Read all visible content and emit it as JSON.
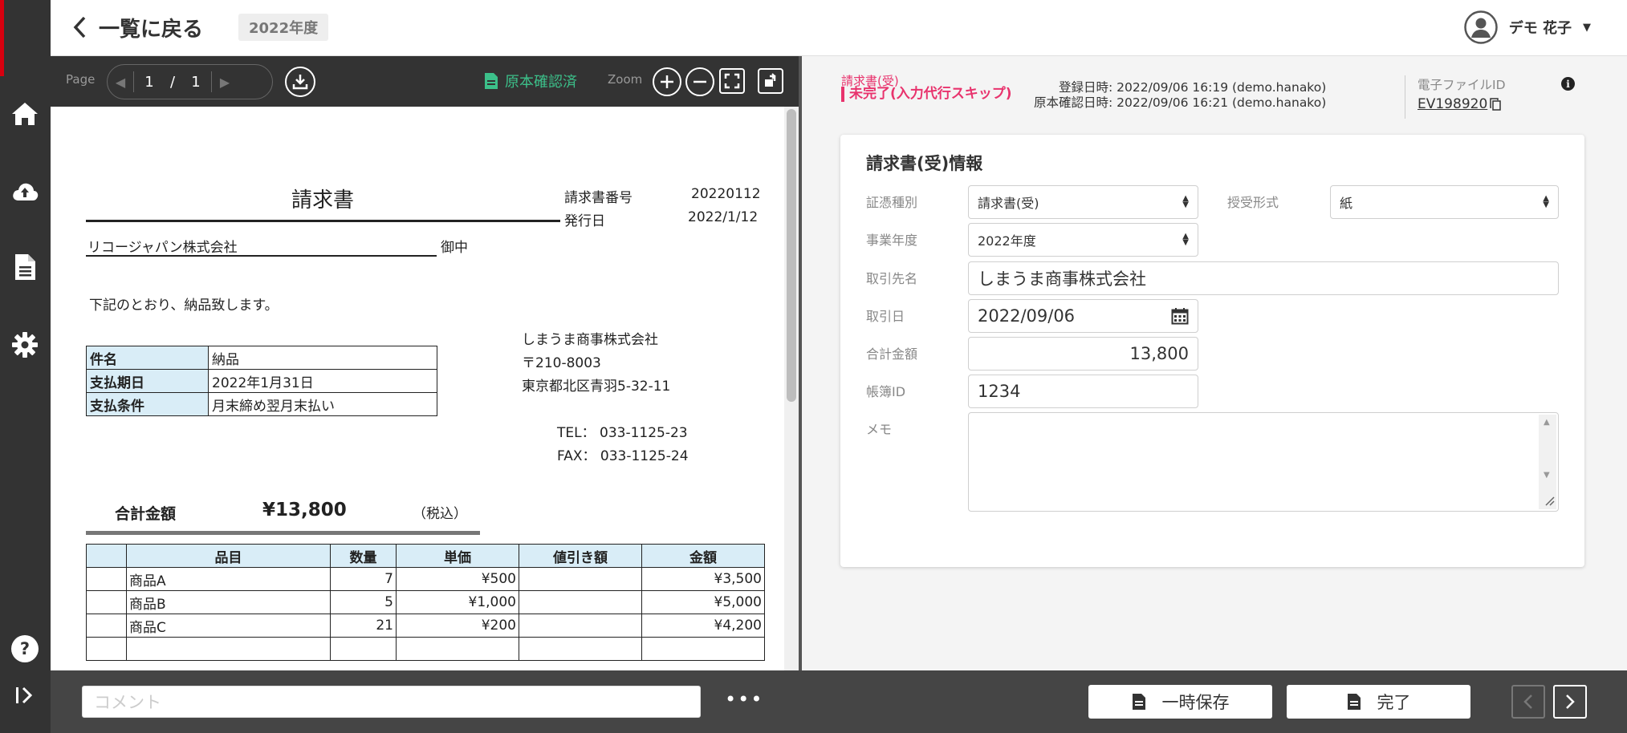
{
  "header": {
    "back_label": "一覧に戻る",
    "fiscal_year_badge": "2022年度",
    "user_name": "デモ 花子",
    "user_caret": "▼"
  },
  "viewer": {
    "page_label": "Page",
    "current_page": "1",
    "page_separator": "/",
    "total_pages": "1",
    "confirmed_label": "原本確認済",
    "zoom_label": "Zoom",
    "confirmed_color": "#3cc08a"
  },
  "document": {
    "title": "請求書",
    "invoice_no_label": "請求書番号",
    "invoice_no": "20220112",
    "issue_date_label": "発行日",
    "issue_date": "2022/1/12",
    "recipient": "リコージャパン株式会社",
    "honorific": "御中",
    "intro": "下記のとおり、納品致します。",
    "issuer_name": "しまうま商事株式会社",
    "issuer_zip": "〒210-8003",
    "issuer_address": "東京都北区青羽5-32-11",
    "tel": "TEL： 033-1125-23",
    "fax": "FAX： 033-1125-24",
    "info_rows": [
      {
        "label": "件名",
        "value": "納品"
      },
      {
        "label": "支払期日",
        "value": "2022年1月31日"
      },
      {
        "label": "支払条件",
        "value": "月末締め翌月末払い"
      }
    ],
    "total_label": "合計金額",
    "total_value": "¥13,800",
    "tax_note": "（税込）",
    "item_headers": [
      "",
      "品目",
      "数量",
      "単価",
      "値引き額",
      "金額"
    ],
    "items": [
      [
        "",
        "商品A",
        "7",
        "¥500",
        "",
        "¥3,500"
      ],
      [
        "",
        "商品B",
        "5",
        "¥1,000",
        "",
        "¥5,000"
      ],
      [
        "",
        "商品C",
        "21",
        "¥200",
        "",
        "¥4,200"
      ],
      [
        "",
        "",
        "",
        "",
        "",
        ""
      ]
    ]
  },
  "meta": {
    "doc_type": "請求書(受)",
    "status": "未完了(入力代行スキップ)",
    "registered": "登録日時: 2022/09/06 16:19 (demo.hanako)",
    "confirmed": "原本確認日時: 2022/09/06 16:21 (demo.hanako)",
    "file_id_label": "電子ファイルID",
    "file_id": "EV198920",
    "status_color": "#e8336d"
  },
  "form": {
    "title": "請求書(受)情報",
    "doc_category_label": "証憑種別",
    "doc_category_value": "請求書(受)",
    "transfer_label": "授受形式",
    "transfer_value": "紙",
    "fiscal_year_label": "事業年度",
    "fiscal_year_value": "2022年度",
    "partner_label": "取引先名",
    "partner_value": "しまうま商事株式会社",
    "date_label": "取引日",
    "date_value": "2022/09/06",
    "amount_label": "合計金額",
    "amount_value": "13,800",
    "book_id_label": "帳簿ID",
    "book_id_value": "1234",
    "memo_label": "メモ",
    "memo_value": ""
  },
  "bottom": {
    "comment_placeholder": "コメント",
    "more_label": "•••",
    "save_label": "一時保存",
    "complete_label": "完了"
  }
}
